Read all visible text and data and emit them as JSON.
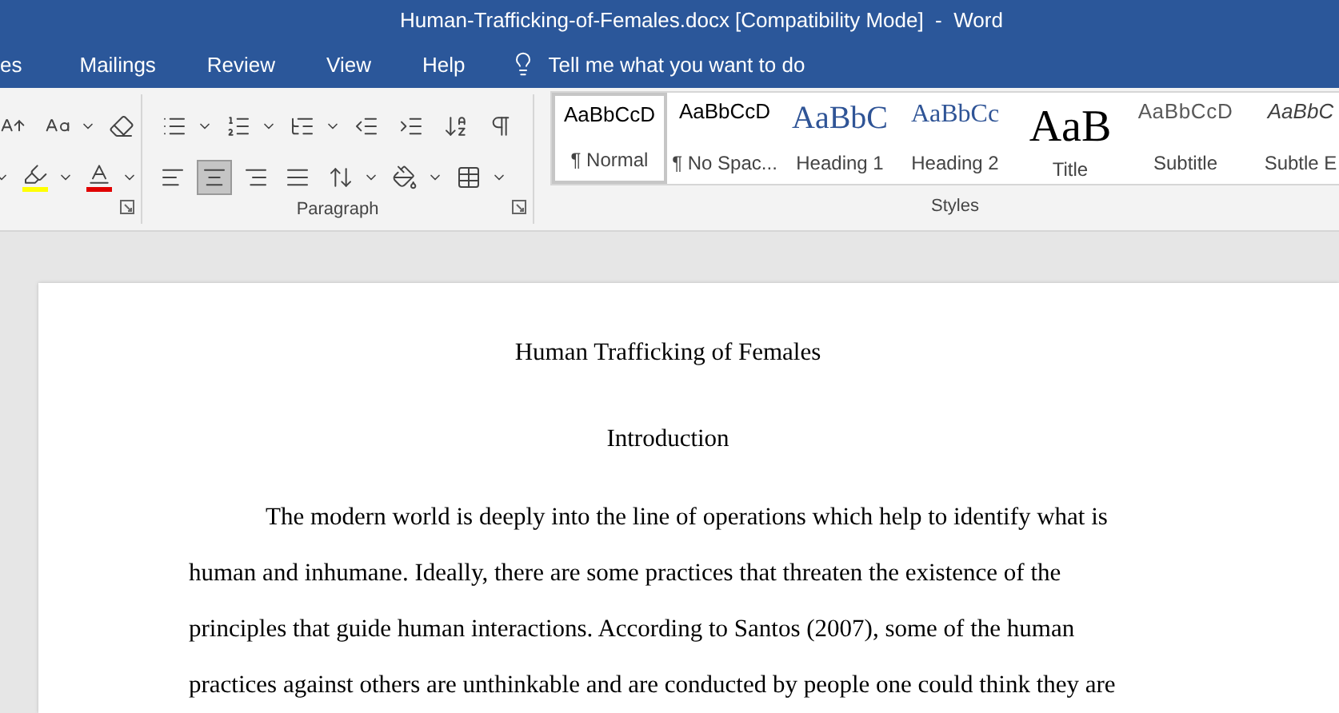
{
  "window": {
    "title": "Human-Trafficking-of-Females.docx [Compatibility Mode]  -  Word"
  },
  "tabs": [
    {
      "label": "es",
      "selected": false
    },
    {
      "label": "Mailings",
      "selected": false
    },
    {
      "label": "Review",
      "selected": false
    },
    {
      "label": "View",
      "selected": false
    },
    {
      "label": "Help",
      "selected": false
    }
  ],
  "tell_me": {
    "placeholder": "Tell me what you want to do"
  },
  "ribbon": {
    "paragraph_group": {
      "label": "Paragraph",
      "alignment": [
        {
          "kind": "left",
          "selected": false
        },
        {
          "kind": "center",
          "selected": true
        },
        {
          "kind": "right",
          "selected": false
        },
        {
          "kind": "justify",
          "selected": false
        }
      ]
    },
    "styles_group": {
      "label": "Styles",
      "styles": [
        {
          "kind": "normal",
          "sample": "AaBbCcD",
          "name": "¶ Normal",
          "selected": true
        },
        {
          "kind": "normal",
          "sample": "AaBbCcD",
          "name": "¶ No Spac...",
          "selected": false
        },
        {
          "kind": "heading1",
          "sample": "AaBbC",
          "name": "Heading 1",
          "selected": false
        },
        {
          "kind": "heading2",
          "sample": "AaBbCc",
          "name": "Heading 2",
          "selected": false
        },
        {
          "kind": "title",
          "sample": "AaB",
          "name": "Title",
          "selected": false
        },
        {
          "kind": "subtitle",
          "sample": "AaBbCcD",
          "name": "Subtitle",
          "selected": false
        },
        {
          "kind": "subtle",
          "sample": "AaBbC",
          "name": "Subtle E",
          "selected": false
        }
      ]
    }
  },
  "document": {
    "title": "Human Trafficking of Females",
    "heading": "Introduction",
    "paragraph": "The modern world is deeply into the line of operations which help to identify what is human and inhumane. Ideally, there are some practices that threaten the existence of the principles that guide human interactions. According to Santos (2007), some of the human practices against others are unthinkable and are conducted by people one could think they are"
  }
}
